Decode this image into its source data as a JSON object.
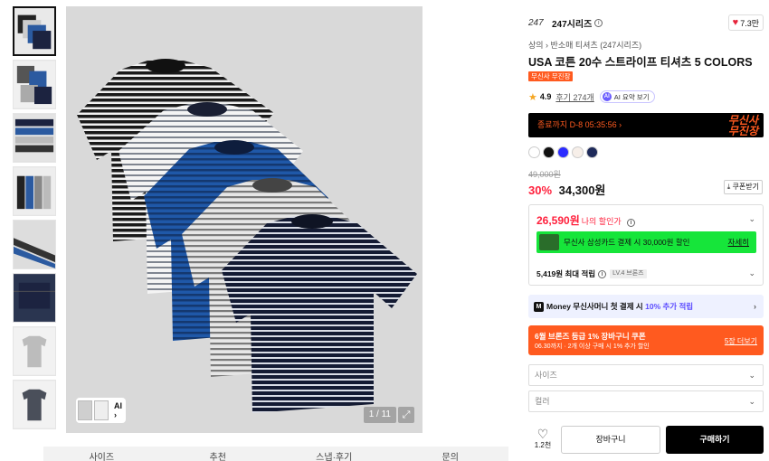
{
  "thumbnails": [
    {
      "name": "thumb-1"
    },
    {
      "name": "thumb-2"
    },
    {
      "name": "thumb-3"
    },
    {
      "name": "thumb-4"
    },
    {
      "name": "thumb-5"
    },
    {
      "name": "thumb-6"
    },
    {
      "name": "thumb-7"
    },
    {
      "name": "thumb-8"
    }
  ],
  "gallery": {
    "ai_label": "AI",
    "ai_arrow": "›",
    "counter": "1 / 11",
    "expand_icon": "⤢"
  },
  "tabs": [
    "사이즈",
    "추천",
    "스냅·후기",
    "문의"
  ],
  "brand": {
    "logo": "247",
    "name": "247시리즈",
    "info": "i",
    "likes": "7.3만"
  },
  "breadcrumb": "상의 › 반소매 티셔츠 (247시리즈)",
  "product_title": "USA 코튼 20수 스트라이프 티셔츠 5 COLORS",
  "badge": "무신사 무진장",
  "rating": {
    "score": "4.9",
    "reviews": "후기 274개",
    "ai_icon": "AI",
    "ai_summary": "AI 요약 보기"
  },
  "timer": {
    "text": "종료까지 D-8 05:35:56 ›",
    "logo_line1": "무신사",
    "logo_line2": "무진장"
  },
  "colors": [
    "#ffffff",
    "#111111",
    "#2b2bff",
    "#f7efe9",
    "#1e2a5a"
  ],
  "price": {
    "original": "49,000원",
    "discount": "30%",
    "final": "34,300원",
    "coupon_button": "⤓ 쿠폰받기"
  },
  "benefits": {
    "my_price": "26,590원",
    "my_price_label": "나의 할인가",
    "card_text": "무신사 삼성카드 결제 시 30,000원 할인",
    "card_more": "자세히",
    "points": "5,419원 최대 적립",
    "level": "LV.4 브론즈"
  },
  "money": {
    "icon": "M",
    "text_pre": "Money  무신사머니 첫 결제 시 ",
    "highlight": "10% 추가 적립"
  },
  "coupon": {
    "title": "6월 브론즈 등급 1% 장바구니 쿠폰",
    "sub": "06.30까지 · 2개 이상 구매 시 1% 추가 할인",
    "more": "5장 더보기"
  },
  "selects": {
    "size": "사이즈",
    "color": "컬러"
  },
  "actions": {
    "wish_count": "1.2천",
    "cart": "장바구니",
    "buy": "구매하기"
  }
}
